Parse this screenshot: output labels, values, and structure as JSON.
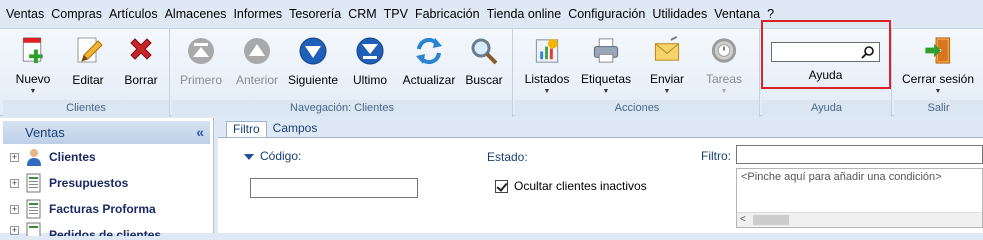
{
  "menu": [
    "Ventas",
    "Compras",
    "Artículos",
    "Almacenes",
    "Informes",
    "Tesorería",
    "CRM",
    "TPV",
    "Fabricación",
    "Tienda online",
    "Configuración",
    "Utilidades",
    "Ventana",
    "?"
  ],
  "ribbon": {
    "clientes": {
      "caption": "Clientes",
      "nuevo": "Nuevo",
      "editar": "Editar",
      "borrar": "Borrar"
    },
    "navegacion": {
      "caption": "Navegación: Clientes",
      "primero": "Primero",
      "anterior": "Anterior",
      "siguiente": "Siguiente",
      "ultimo": "Ultimo",
      "actualizar": "Actualizar",
      "buscar": "Buscar"
    },
    "acciones": {
      "caption": "Acciones",
      "listados": "Listados",
      "etiquetas": "Etiquetas",
      "enviar": "Enviar",
      "tareas": "Tareas"
    },
    "ayuda": {
      "caption": "Ayuda",
      "search_value": "",
      "label": "Ayuda"
    },
    "salir": {
      "caption": "Salir",
      "cerrar": "Cerrar sesión"
    }
  },
  "left_panel": {
    "title": "Ventas",
    "items": [
      {
        "label": "Clientes",
        "icon": "client-icon"
      },
      {
        "label": "Presupuestos",
        "icon": "document-icon"
      },
      {
        "label": "Facturas Proforma",
        "icon": "document-icon"
      },
      {
        "label": "Pedidos de clientes",
        "icon": "document-icon"
      }
    ]
  },
  "main": {
    "tabs": [
      "Filtro",
      "Campos"
    ],
    "filter": {
      "codigo_label": "Código:",
      "codigo_value": "",
      "estado_label": "Estado:",
      "ocultar_label": "Ocultar clientes inactivos",
      "ocultar_checked": true,
      "filtro_label": "Filtro:",
      "filtro_value": "",
      "condition_hint": "<Pinche aquí para añadir una condición>"
    }
  }
}
